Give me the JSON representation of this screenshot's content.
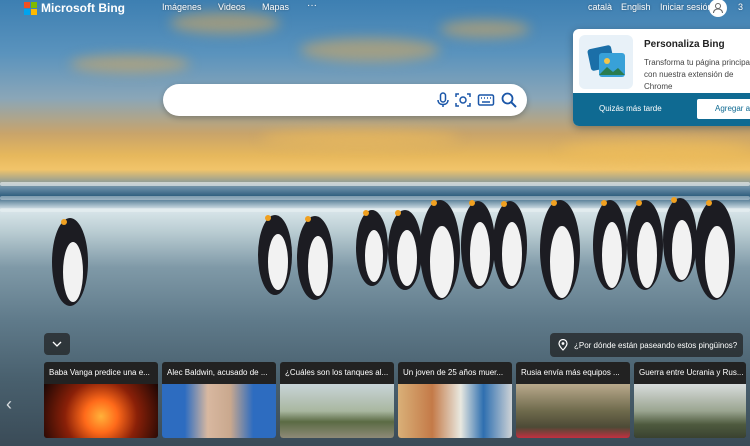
{
  "app": {
    "brand": "Microsoft Bing"
  },
  "nav": {
    "items": [
      "Imágenes",
      "Videos",
      "Mapas"
    ],
    "more": "···"
  },
  "header_right": {
    "lang1": "català",
    "lang2": "English",
    "signin": "Iniciar sesión",
    "points": "3"
  },
  "search": {
    "placeholder": ""
  },
  "icons": [
    "microphone-icon",
    "visual-search-icon",
    "keyboard-icon",
    "search-icon"
  ],
  "promo": {
    "title": "Personaliza Bing",
    "description": "Transforma tu página principal con nuestra extensión de Chrome",
    "later_label": "Quizás más tarde",
    "add_label": "Agregar a"
  },
  "quiz": {
    "text": "¿Por dónde están paseando estos pingüinos?"
  },
  "news": [
    {
      "title": "Baba Vanga predice una e..."
    },
    {
      "title": "Alec Baldwin, acusado de ..."
    },
    {
      "title": "¿Cuáles son los tanques al..."
    },
    {
      "title": "Un joven de 25 años muer..."
    },
    {
      "title": "Rusia envía más equipos ..."
    },
    {
      "title": "Guerra entre Ucrania y Rus..."
    }
  ],
  "colors": {
    "accent": "#0f6a92",
    "bing_blue": "#1a56a8"
  }
}
